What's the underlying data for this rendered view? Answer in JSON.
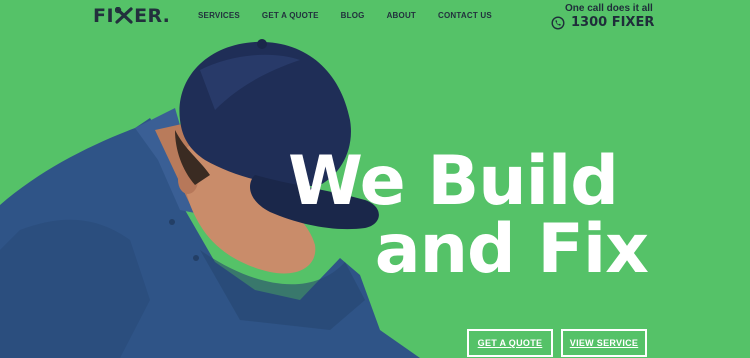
{
  "header": {
    "logo_text_start": "FI",
    "logo_text_end": "ER",
    "nav": [
      {
        "label": "SERVICES"
      },
      {
        "label": "GET A QUOTE"
      },
      {
        "label": "BLOG"
      },
      {
        "label": "ABOUT"
      },
      {
        "label": "CONTACT US"
      }
    ],
    "call_tagline": "One call does it all",
    "phone_number": "1300 FIXER"
  },
  "hero": {
    "headline_line1": "We Build",
    "headline_line2": "and Fix",
    "buttons": {
      "quote": "GET A QUOTE",
      "service": "VIEW SERVICE"
    }
  },
  "colors": {
    "background": "#55c268",
    "text_dark": "#22303d",
    "shirt": "#2f5487",
    "cap": "#1f2e57",
    "skin": "#c98c6a",
    "white": "#ffffff"
  },
  "icons": {
    "logo_mark": "crossed-wrench-screwdriver-icon",
    "phone": "phone-in-hand-icon"
  }
}
